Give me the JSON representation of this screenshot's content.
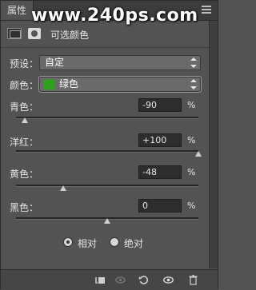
{
  "panel": {
    "tab_label": "属性",
    "watermark": "www.240ps.com",
    "adjustment_title": "可选颜色"
  },
  "preset": {
    "label": "预设：",
    "value": "自定"
  },
  "colors": {
    "label": "颜色：",
    "value": "绿色",
    "swatch_color": "#2ba21a"
  },
  "sliders": [
    {
      "label": "青色：",
      "value": "-90",
      "unit": "%",
      "level": -90
    },
    {
      "label": "洋红：",
      "value": "+100",
      "unit": "%",
      "level": 100
    },
    {
      "label": "黄色：",
      "value": "-48",
      "unit": "%",
      "level": -48
    },
    {
      "label": "黑色：",
      "value": "0",
      "unit": "%",
      "level": 0
    }
  ],
  "method": {
    "options": [
      "相对",
      "绝对"
    ],
    "selected": "相对"
  },
  "bottom_icons": [
    "clip-to-layer-icon",
    "view-previous-icon",
    "reset-icon",
    "visibility-eye-icon",
    "delete-icon"
  ]
}
